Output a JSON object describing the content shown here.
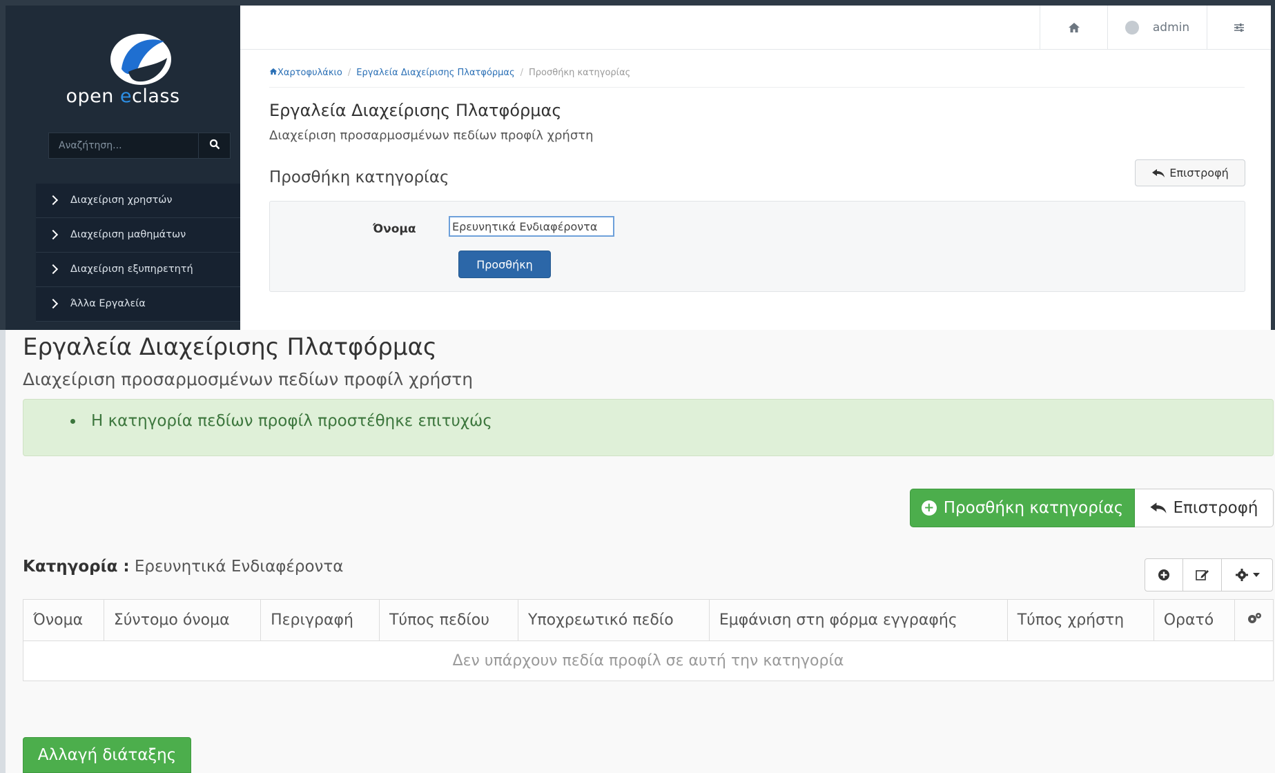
{
  "sidebar": {
    "logo_prefix": "open ",
    "logo_accent": "e",
    "logo_suffix": "class",
    "search_placeholder": "Αναζήτηση...",
    "items": [
      {
        "label": "Διαχείριση χρηστών"
      },
      {
        "label": "Διαχείριση μαθημάτων"
      },
      {
        "label": "Διαχείριση εξυπηρετητή"
      },
      {
        "label": "Άλλα Εργαλεία"
      }
    ]
  },
  "topbar": {
    "user_name": "admin"
  },
  "breadcrumb": {
    "home": "Χαρτοφυλάκιο",
    "tools": "Εργαλεία Διαχείρισης Πλατφόρμας",
    "current": "Προσθήκη κατηγορίας"
  },
  "add_form": {
    "title": "Εργαλεία Διαχείρισης Πλατφόρμας",
    "subtitle": "Διαχείριση προσαρμοσμένων πεδίων προφίλ χρήστη",
    "heading": "Προσθήκη κατηγορίας",
    "back_label": "Επιστροφή",
    "name_label": "Όνομα",
    "name_value": "Ερευνητικά Ενδιαφέροντα",
    "submit_label": "Προσθήκη"
  },
  "result": {
    "title": "Εργαλεία Διαχείρισης Πλατφόρμας",
    "subtitle": "Διαχείριση προσαρμοσμένων πεδίων προφίλ χρήστη",
    "success_message": "Η κατηγορία πεδίων προφίλ προστέθηκε επιτυχώς",
    "add_category_label": "Προσθήκη κατηγορίας",
    "back_label": "Επιστροφή",
    "category_key": "Κατηγορία :",
    "category_value": "Ερευνητικά Ενδιαφέροντα",
    "table": {
      "columns": [
        "Όνομα",
        "Σύντομο όνομα",
        "Περιγραφή",
        "Τύπος πεδίου",
        "Υποχρεωτικό πεδίο",
        "Εμφάνιση στη φόρμα εγγραφής",
        "Τύπος χρήστη",
        "Ορατό"
      ],
      "empty_message": "Δεν υπάρχουν πεδία προφίλ σε αυτή την κατηγορία"
    },
    "reorder_label": "Αλλαγή διάταξης"
  },
  "colors": {
    "sidebar_bg": "#1f2b38",
    "primary": "#2c67a8",
    "success": "#4cae4c",
    "alert_bg": "#dff0d8",
    "alert_text": "#3c763d"
  }
}
